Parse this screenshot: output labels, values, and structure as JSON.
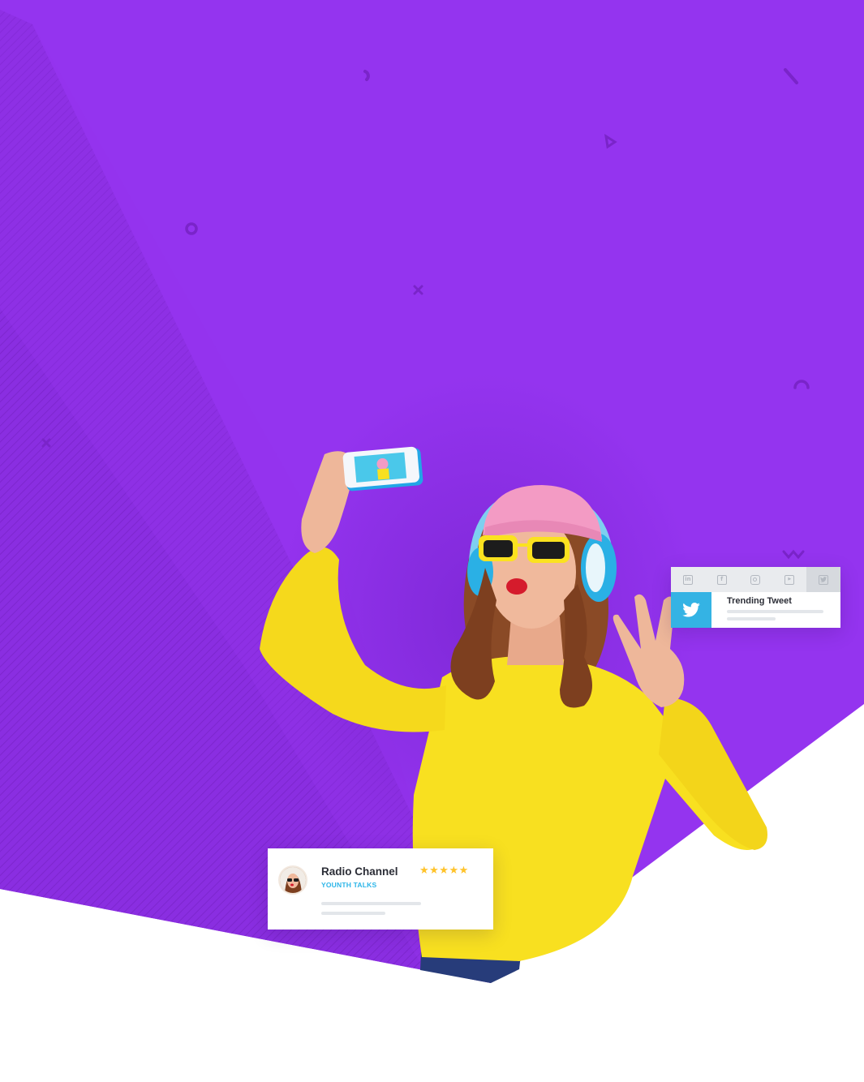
{
  "colors": {
    "hero_purple": "#9434ef",
    "accent_cyan": "#2cb5e8",
    "twitter_blue": "#34b3e4",
    "star_yellow": "#ffc32b",
    "sweater_yellow": "#f8e020",
    "beanie_pink": "#f39bc4"
  },
  "tweet_card": {
    "tabs": [
      {
        "icon": "linkedin-icon",
        "glyph": "in",
        "active": false
      },
      {
        "icon": "facebook-icon",
        "glyph": "f",
        "active": false
      },
      {
        "icon": "instagram-icon",
        "glyph": "",
        "active": false
      },
      {
        "icon": "youtube-icon",
        "glyph": "▶",
        "active": false
      },
      {
        "icon": "twitter-icon",
        "glyph": "",
        "active": true
      }
    ],
    "brand_icon": "twitter-bird-icon",
    "title": "Trending Tweet"
  },
  "radio_card": {
    "avatar_icon": "avatar",
    "title": "Radio Channel",
    "subtitle": "YOUNTH TALKS",
    "stars": "★★★★★",
    "rating": 5
  }
}
